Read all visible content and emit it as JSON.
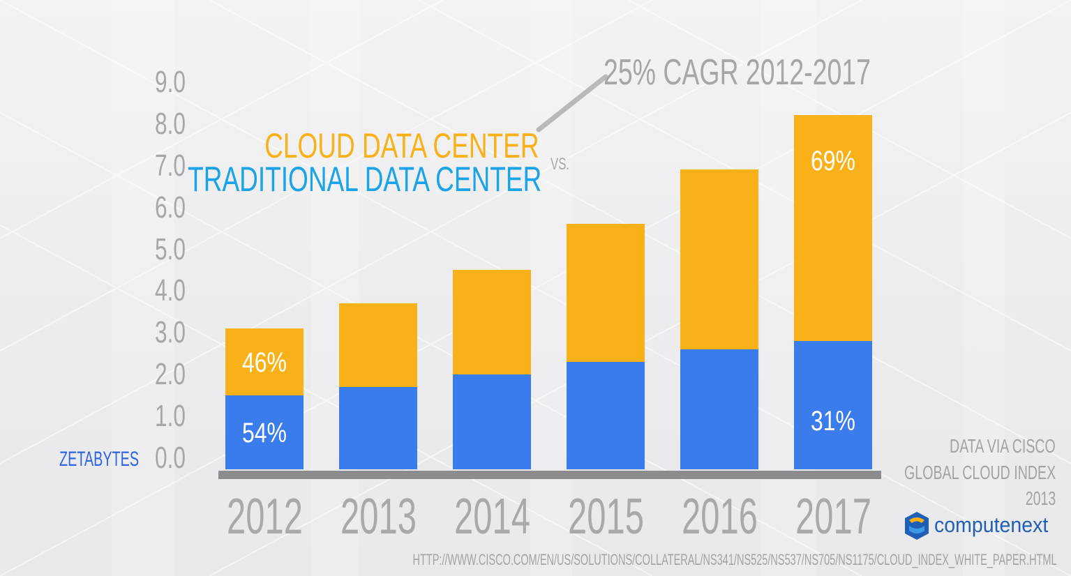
{
  "chart_data": {
    "type": "bar",
    "stacked": true,
    "annotation": "25% CAGR 2012-2017",
    "legend": {
      "cloud_label": "CLOUD DATA CENTER",
      "vs_label": "VS.",
      "traditional_label": "TRADITIONAL DATA CENTER"
    },
    "ylabel": "ZETABYTES",
    "ylim": [
      0,
      9
    ],
    "yticks": [
      "0.0",
      "1.0",
      "2.0",
      "3.0",
      "4.0",
      "5.0",
      "6.0",
      "7.0",
      "8.0",
      "9.0"
    ],
    "categories": [
      "2012",
      "2013",
      "2014",
      "2015",
      "2016",
      "2017"
    ],
    "series": [
      {
        "name": "TRADITIONAL DATA CENTER",
        "color": "#3b7ced",
        "values": [
          1.5,
          1.7,
          2.0,
          2.3,
          2.6,
          2.8
        ]
      },
      {
        "name": "CLOUD DATA CENTER",
        "color": "#f9b119",
        "values": [
          1.6,
          2.0,
          2.5,
          3.3,
          4.3,
          5.4
        ]
      }
    ],
    "data_labels": [
      {
        "category": "2012",
        "series": "CLOUD DATA CENTER",
        "text": "46%"
      },
      {
        "category": "2012",
        "series": "TRADITIONAL DATA CENTER",
        "text": "54%"
      },
      {
        "category": "2017",
        "series": "CLOUD DATA CENTER",
        "text": "69%"
      },
      {
        "category": "2017",
        "series": "TRADITIONAL DATA CENTER",
        "text": "31%"
      }
    ],
    "grid": false
  },
  "source": {
    "line1": "DATA VIA CISCO",
    "line2": "GLOBAL CLOUD INDEX",
    "line3": "2013",
    "url": "HTTP://WWW.CISCO.COM/EN/US/SOLUTIONS/COLLATERAL/NS341/NS525/NS537/NS705/NS1175/CLOUD_INDEX_WHITE_PAPER.HTML"
  },
  "logo": {
    "text": "computenext",
    "icon": "computenext-logo-icon"
  },
  "colors": {
    "cloud": "#f9b119",
    "traditional": "#3b7ced",
    "legend_traditional": "#1aa3e6",
    "axis_text": "#a7a7aa",
    "ylabel": "#2f64e0"
  }
}
